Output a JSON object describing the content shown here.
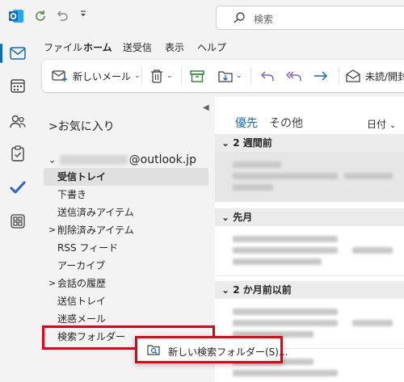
{
  "search": {
    "placeholder": "検索"
  },
  "menu": {
    "tabs": [
      "ファイル",
      "ホーム",
      "送受信",
      "表示",
      "ヘルプ"
    ],
    "active_tab": "ホーム"
  },
  "ribbon": {
    "new_mail_label": "新しいメール",
    "read_unread_label": "未読/開封"
  },
  "folders": {
    "favorites_label": "お気に入り",
    "account_email": "@outlook.jp",
    "items": [
      {
        "label": "受信トレイ",
        "selected": true,
        "expandable": false
      },
      {
        "label": "下書き",
        "selected": false,
        "expandable": false
      },
      {
        "label": "送信済みアイテム",
        "selected": false,
        "expandable": false
      },
      {
        "label": "削除済みアイテム",
        "selected": false,
        "expandable": true
      },
      {
        "label": "RSS フィード",
        "selected": false,
        "expandable": false
      },
      {
        "label": "アーカイブ",
        "selected": false,
        "expandable": false
      },
      {
        "label": "会話の履歴",
        "selected": false,
        "expandable": true
      },
      {
        "label": "送信トレイ",
        "selected": false,
        "expandable": false
      },
      {
        "label": "迷惑メール",
        "selected": false,
        "expandable": false
      },
      {
        "label": "検索フォルダー",
        "selected": false,
        "expandable": false
      }
    ]
  },
  "message_list": {
    "tab_focused": "優先",
    "tab_other": "その他",
    "sort_label": "日付",
    "groups": [
      "2 週間前",
      "先月",
      "2 か月前以前"
    ]
  },
  "context_menu": {
    "new_search_folder_label": "新しい検索フォルダー(S)..."
  },
  "colors": {
    "accent": "#0f6cbd",
    "highlight": "#e60012",
    "refresh": "#5b8a3c"
  }
}
